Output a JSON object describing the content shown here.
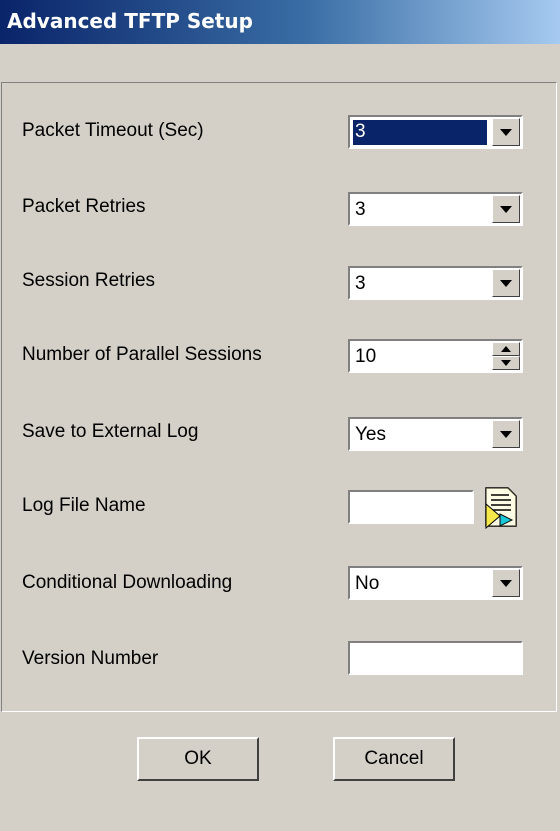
{
  "window": {
    "title": "Advanced TFTP Setup"
  },
  "fields": {
    "packet_timeout": {
      "label": "Packet Timeout (Sec)",
      "value": "3"
    },
    "packet_retries": {
      "label": "Packet Retries",
      "value": "3"
    },
    "session_retries": {
      "label": "Session Retries",
      "value": "3"
    },
    "parallel_sessions": {
      "label": "Number of Parallel Sessions",
      "value": "10"
    },
    "external_log": {
      "label": "Save to External Log",
      "value": "Yes"
    },
    "log_file_name": {
      "label": "Log File Name",
      "value": ""
    },
    "conditional_downloading": {
      "label": "Conditional Downloading",
      "value": "No"
    },
    "version_number": {
      "label": "Version Number",
      "value": ""
    }
  },
  "buttons": {
    "ok": "OK",
    "cancel": "Cancel"
  },
  "icons": {
    "dropdown": "chevron-down-icon",
    "spinner": "up-down-spinner-icon",
    "browse": "browse-file-icon"
  },
  "colors": {
    "title_bar_start": "#0a246a",
    "title_bar_end": "#a6caf0",
    "dialog_bg": "#d4d0c8",
    "selection": "#0a246a"
  }
}
